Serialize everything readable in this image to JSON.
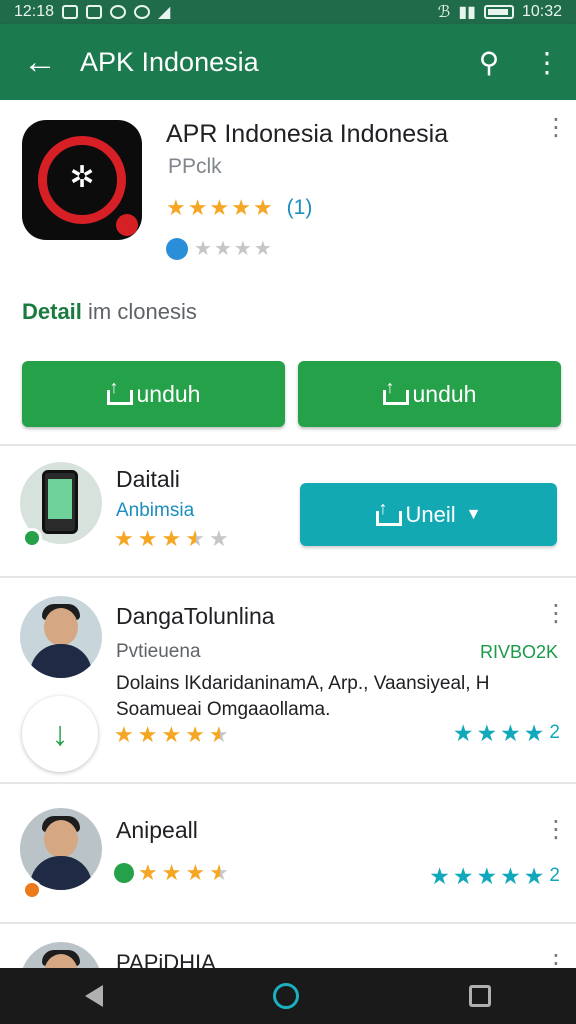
{
  "status_bar": {
    "time": "12:18",
    "right_time": "10:32"
  },
  "app_bar": {
    "title": "APK Indonesia"
  },
  "app": {
    "name": "APR Indonesia Indonesia",
    "developer": "PPclk",
    "rating_count": "(1)",
    "rating": 4.5,
    "detail_label_bold": "Detail",
    "detail_label_rest": " im clonesis"
  },
  "buttons": {
    "left_label": "unduh",
    "right_label": "unduh"
  },
  "items": [
    {
      "title": "Daitali",
      "subtitle": "Anbimsia",
      "button_label": "Uneil"
    },
    {
      "title": "DangaTolunlina",
      "subtitle": "Pvtieuena",
      "right_label": "RIVBO2K",
      "description": "Dolains lKdaridaninamA, Arp., Vaansiyeal, H Soamueai Omgaaollama.",
      "right_rating_num": "2"
    },
    {
      "title": "Anipeall",
      "right_rating_num": "2"
    },
    {
      "title": "PAPiDHIA"
    }
  ],
  "colors": {
    "app_bar": "#1b7a4e",
    "primary_button": "#24a149",
    "secondary_button": "#13a9b3",
    "star": "#f5a623",
    "teal_star": "#12a8bc"
  },
  "icons": [
    "back-arrow-icon",
    "search-icon",
    "more-vert-icon",
    "download-icon",
    "dropdown-caret-icon"
  ]
}
